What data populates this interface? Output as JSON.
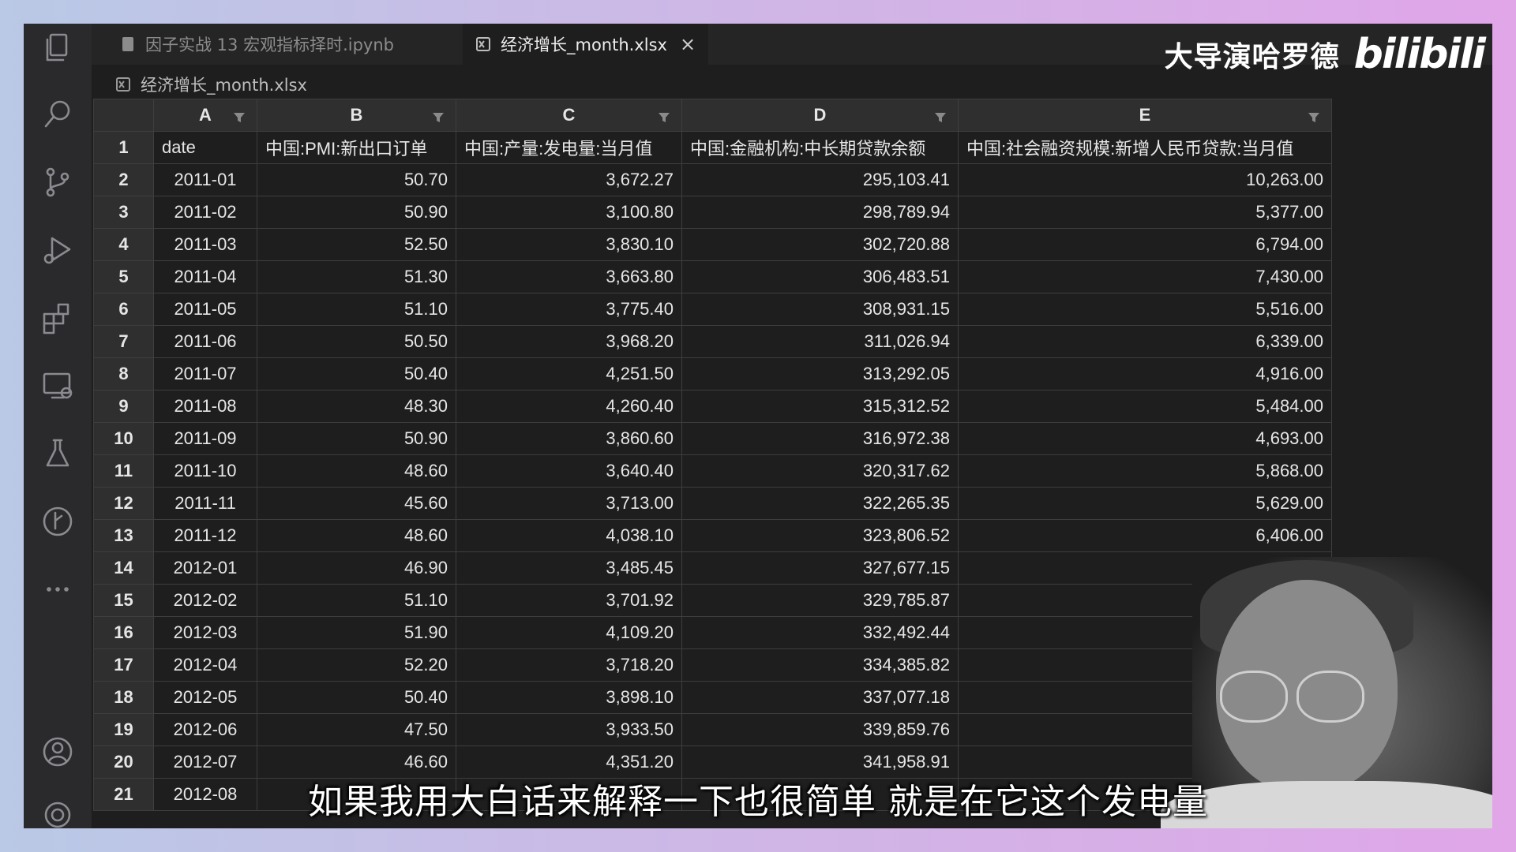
{
  "tabs": [
    {
      "label": "因子实战 13 宏观指标择时.ipynb",
      "icon": "notebook-icon"
    },
    {
      "label": "经济增长_month.xlsx",
      "icon": "excel-icon",
      "close": "×"
    }
  ],
  "breadcrumb": {
    "label": "经济增长_month.xlsx",
    "icon": "excel-icon"
  },
  "brand": {
    "name": "大导演哈罗德",
    "logo": "bilibili"
  },
  "columns": [
    "A",
    "B",
    "C",
    "D",
    "E"
  ],
  "header_row": {
    "num": "1",
    "cells": [
      "date",
      "中国:PMI:新出口订单",
      "中国:产量:发电量:当月值",
      "中国:金融机构:中长期贷款余额",
      "中国:社会融资规模:新增人民币贷款:当月值"
    ]
  },
  "rows": [
    {
      "num": "2",
      "cells": [
        "2011-01",
        "50.70",
        "3,672.27",
        "295,103.41",
        "10,263.00"
      ]
    },
    {
      "num": "3",
      "cells": [
        "2011-02",
        "50.90",
        "3,100.80",
        "298,789.94",
        "5,377.00"
      ]
    },
    {
      "num": "4",
      "cells": [
        "2011-03",
        "52.50",
        "3,830.10",
        "302,720.88",
        "6,794.00"
      ]
    },
    {
      "num": "5",
      "cells": [
        "2011-04",
        "51.30",
        "3,663.80",
        "306,483.51",
        "7,430.00"
      ]
    },
    {
      "num": "6",
      "cells": [
        "2011-05",
        "51.10",
        "3,775.40",
        "308,931.15",
        "5,516.00"
      ]
    },
    {
      "num": "7",
      "cells": [
        "2011-06",
        "50.50",
        "3,968.20",
        "311,026.94",
        "6,339.00"
      ]
    },
    {
      "num": "8",
      "cells": [
        "2011-07",
        "50.40",
        "4,251.50",
        "313,292.05",
        "4,916.00"
      ]
    },
    {
      "num": "9",
      "cells": [
        "2011-08",
        "48.30",
        "4,260.40",
        "315,312.52",
        "5,484.00"
      ]
    },
    {
      "num": "10",
      "cells": [
        "2011-09",
        "50.90",
        "3,860.60",
        "316,972.38",
        "4,693.00"
      ]
    },
    {
      "num": "11",
      "cells": [
        "2011-10",
        "48.60",
        "3,640.40",
        "320,317.62",
        "5,868.00"
      ]
    },
    {
      "num": "12",
      "cells": [
        "2011-11",
        "45.60",
        "3,713.00",
        "322,265.35",
        "5,629.00"
      ]
    },
    {
      "num": "13",
      "cells": [
        "2011-12",
        "48.60",
        "4,038.10",
        "323,806.52",
        "6,406.00"
      ]
    },
    {
      "num": "14",
      "cells": [
        "2012-01",
        "46.90",
        "3,485.45",
        "327,677.15",
        ""
      ]
    },
    {
      "num": "15",
      "cells": [
        "2012-02",
        "51.10",
        "3,701.92",
        "329,785.87",
        ""
      ]
    },
    {
      "num": "16",
      "cells": [
        "2012-03",
        "51.90",
        "4,109.20",
        "332,492.44",
        ""
      ]
    },
    {
      "num": "17",
      "cells": [
        "2012-04",
        "52.20",
        "3,718.20",
        "334,385.82",
        ""
      ]
    },
    {
      "num": "18",
      "cells": [
        "2012-05",
        "50.40",
        "3,898.10",
        "337,077.18",
        ""
      ]
    },
    {
      "num": "19",
      "cells": [
        "2012-06",
        "47.50",
        "3,933.50",
        "339,859.76",
        ""
      ]
    },
    {
      "num": "20",
      "cells": [
        "2012-07",
        "46.60",
        "4,351.20",
        "341,958.91",
        ""
      ]
    },
    {
      "num": "21",
      "cells": [
        "2012-08",
        "",
        "",
        "",
        ""
      ]
    }
  ],
  "subtitle": "如果我用大白话来解释一下也很简单 就是在它这个发电量",
  "activity_bar": [
    "explorer-icon",
    "search-icon",
    "source-control-icon",
    "run-debug-icon",
    "extensions-icon",
    "remote-explorer-icon",
    "testing-icon",
    "timeline-icon",
    "more-icon",
    "account-icon",
    "settings-gear-icon"
  ]
}
